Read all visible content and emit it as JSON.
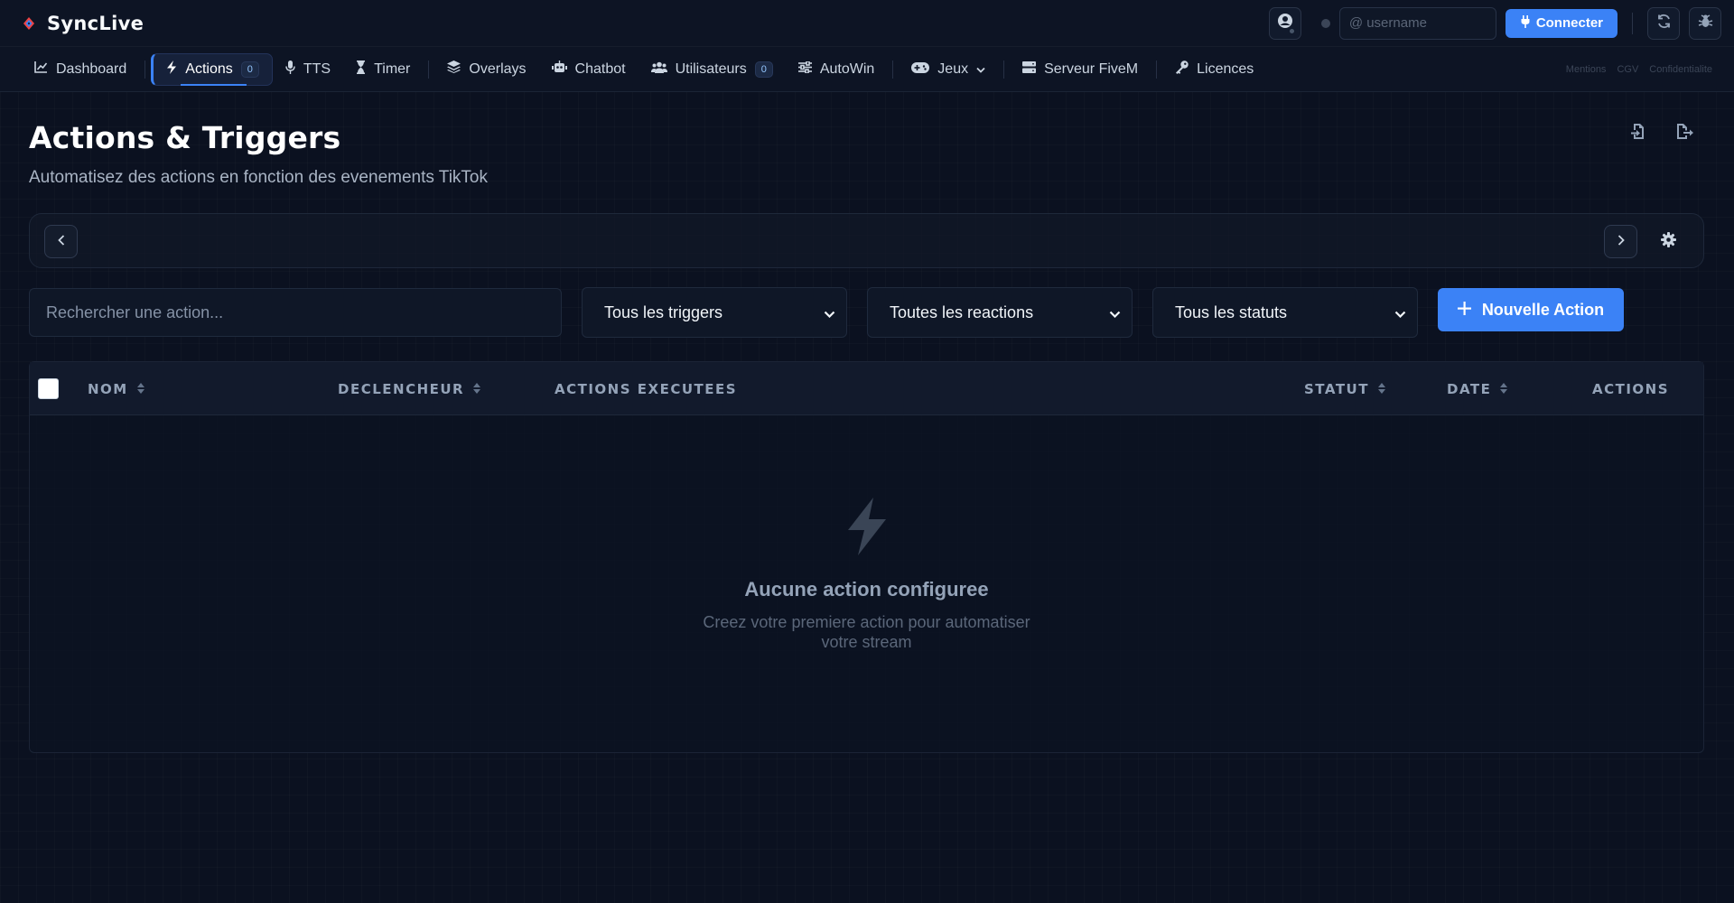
{
  "app": {
    "name": "SyncLive"
  },
  "topbar": {
    "username_placeholder": "@ username",
    "connect_label": "Connecter"
  },
  "nav": {
    "dashboard": "Dashboard",
    "actions": "Actions",
    "actions_badge": "0",
    "tts": "TTS",
    "timer": "Timer",
    "overlays": "Overlays",
    "chatbot": "Chatbot",
    "utilisateurs": "Utilisateurs",
    "utilisateurs_badge": "0",
    "autowin": "AutoWin",
    "jeux": "Jeux",
    "serveur": "Serveur FiveM",
    "licences": "Licences",
    "legal": {
      "mentions": "Mentions",
      "cgv": "CGV",
      "confidentialite": "Confidentialite"
    }
  },
  "page": {
    "title": "Actions & Triggers",
    "subtitle": "Automatisez des actions en fonction des evenements TikTok"
  },
  "filters": {
    "search_placeholder": "Rechercher une action...",
    "triggers": "Tous les triggers",
    "reactions": "Toutes les reactions",
    "statuts": "Tous les statuts",
    "new_action": "Nouvelle Action"
  },
  "table": {
    "columns": {
      "nom": "NOM",
      "declencheur": "DECLENCHEUR",
      "actions_executees": "ACTIONS EXECUTEES",
      "statut": "STATUT",
      "date": "DATE",
      "actions": "ACTIONS"
    },
    "empty_title": "Aucune action configuree",
    "empty_line1": "Creez votre premiere action pour automatiser",
    "empty_line2": "votre stream"
  },
  "colors": {
    "accent": "#3b82f6",
    "background": "#0b1120",
    "logo_red": "#ef4444",
    "logo_blue": "#3b82f6"
  },
  "icons": [
    "logo-icon",
    "user-icon",
    "plug-icon",
    "refresh-icon",
    "bug-icon",
    "chart-icon",
    "bolt-icon",
    "mic-icon",
    "hourglass-icon",
    "layers-icon",
    "robot-icon",
    "users-icon",
    "sliders-icon",
    "gamepad-icon",
    "chevron-down-icon",
    "server-icon",
    "key-icon",
    "import-icon",
    "export-icon",
    "chevron-left-icon",
    "chevron-right-icon",
    "gear-icon",
    "sort-icon",
    "plus-icon"
  ]
}
